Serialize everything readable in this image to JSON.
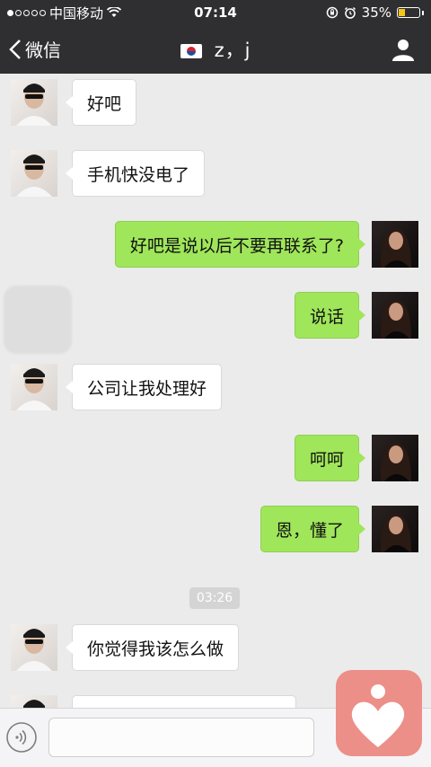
{
  "status_bar": {
    "carrier": "中国移动",
    "time": "07:14",
    "battery": "35%",
    "battery_level": 0.35,
    "icons": [
      "signal-dots-icon",
      "wifi-icon",
      "orientation-lock-icon",
      "alarm-icon",
      "battery-icon"
    ]
  },
  "nav": {
    "back_label": "微信",
    "title": "z，j",
    "icons": [
      "back-chevron-icon",
      "korea-flag-icon",
      "user-profile-icon"
    ]
  },
  "messages": [
    {
      "side": "left",
      "text": "好吧"
    },
    {
      "side": "left",
      "text": "手机快没电了"
    },
    {
      "side": "right",
      "text": "好吧是说以后不要再联系了?"
    },
    {
      "side": "right",
      "text": "说话"
    },
    {
      "side": "left",
      "text": "公司让我处理好"
    },
    {
      "side": "right",
      "text": "呵呵"
    },
    {
      "side": "right",
      "text": "恩，懂了"
    },
    {
      "side": "left",
      "text": "你觉得我该怎么做"
    },
    {
      "side": "left",
      "text": ""
    }
  ],
  "timestamp": "03:26",
  "input": {
    "value": "",
    "placeholder": ""
  },
  "colors": {
    "bar_bg": "#2f2f31",
    "chat_bg": "#ebebeb",
    "right_bubble": "#9fe65a",
    "left_bubble": "#ffffff",
    "battery": "#f5c518",
    "overlay": "#ec8f88"
  }
}
